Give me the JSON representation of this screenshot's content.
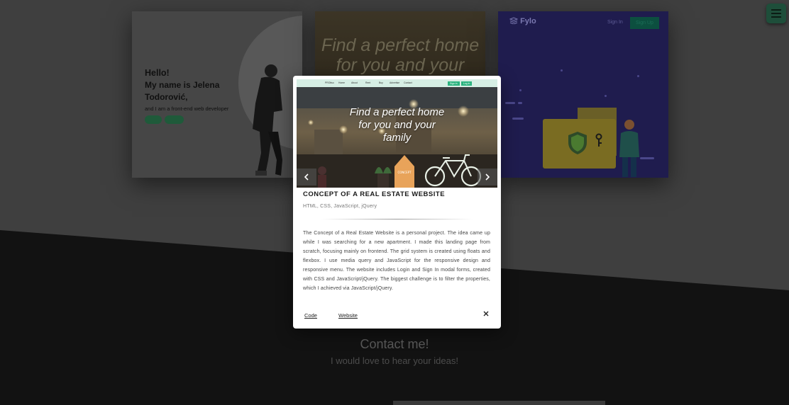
{
  "background": {
    "portfolio_card": {
      "hello": "Hello!",
      "name": "My name is Jelena Todorović,",
      "subtitle": "and I am a front-end web developer",
      "buttons": [
        "",
        ""
      ]
    },
    "real_estate_card": {
      "title_line1": "Find a perfect home",
      "title_line2": "for you and your"
    },
    "fylo_card": {
      "logo": "Fylo",
      "sign_in": "Sign In",
      "sign_up": "Sign Up"
    },
    "contact": {
      "title": "Contact me!",
      "subtitle": "I would love to hear your ideas!"
    }
  },
  "menu_button": {
    "icon": "hamburger-icon"
  },
  "modal": {
    "slide": {
      "nav_items": [
        "PROtiso",
        "Home",
        "About",
        "Rent",
        "Buy",
        "Advertise",
        "Contact"
      ],
      "nav_buttons": [
        "Sign In",
        "Log In"
      ],
      "title_line1": "Find a perfect home",
      "title_line2": "for you and your",
      "title_line3": "family",
      "sign_text": "CONCEPT"
    },
    "title": "CONCEPT OF A REAL ESTATE WEBSITE",
    "tech": "HTML, CSS, JavaScript, jQuery",
    "description": "The Concept of a Real Estate Website is a personal project. The idea came up while I was searching for a new apartment. I made this landing page from scratch, focusing mainly on frontend. The grid system is created using floats and flexbox. I use media query and JavaScript for the responsive design and responsive menu. The website includes Login and Sign In modal forms, created with CSS and JavaScript/jQuery. The biggest challenge is to filter the properties, which I achieved via JavaScript/jQuery.",
    "links": {
      "code": "Code",
      "website": "Website"
    },
    "close_icon": "close-icon"
  },
  "colors": {
    "overlay_bg": "#3f3f3f",
    "dark_section": "#121212",
    "accent_green": "#2bb37f",
    "modal_bg": "#ffffff"
  }
}
